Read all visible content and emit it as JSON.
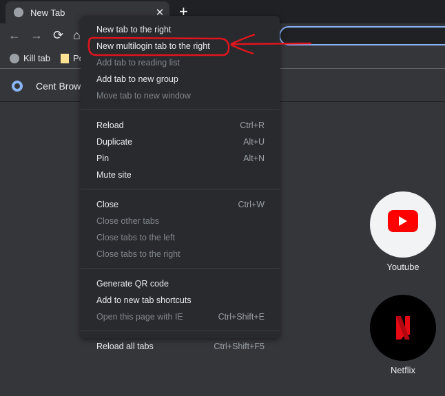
{
  "tab": {
    "title": "New Tab",
    "close": "✕",
    "new_tab": "+"
  },
  "toolbar": {
    "back": "←",
    "forward": "→",
    "reload": "⟳",
    "home": "⌂"
  },
  "bookmarks": [
    {
      "label": "Kill tab"
    },
    {
      "label": "Po"
    }
  ],
  "cent": {
    "label": "Cent Browser"
  },
  "menu": {
    "groups": [
      [
        {
          "label": "New tab to the right",
          "enabled": true
        },
        {
          "label": "New multilogin tab to the right",
          "enabled": true,
          "highlighted": true
        },
        {
          "label": "Add tab to reading list",
          "enabled": false
        },
        {
          "label": "Add tab to new group",
          "enabled": true
        },
        {
          "label": "Move tab to new window",
          "enabled": false
        }
      ],
      [
        {
          "label": "Reload",
          "shortcut": "Ctrl+R",
          "enabled": true
        },
        {
          "label": "Duplicate",
          "shortcut": "Alt+U",
          "enabled": true
        },
        {
          "label": "Pin",
          "shortcut": "Alt+N",
          "enabled": true
        },
        {
          "label": "Mute site",
          "enabled": true
        }
      ],
      [
        {
          "label": "Close",
          "shortcut": "Ctrl+W",
          "enabled": true
        },
        {
          "label": "Close other tabs",
          "enabled": false
        },
        {
          "label": "Close tabs to the left",
          "enabled": false
        },
        {
          "label": "Close tabs to the right",
          "enabled": false
        }
      ],
      [
        {
          "label": "Generate QR code",
          "enabled": true
        },
        {
          "label": "Add to new tab shortcuts",
          "enabled": true
        },
        {
          "label": "Open this page with IE",
          "shortcut": "Ctrl+Shift+E",
          "enabled": false
        }
      ],
      [
        {
          "label": "Reload all tabs",
          "shortcut": "Ctrl+Shift+F5",
          "enabled": true
        }
      ]
    ]
  },
  "shortcuts": [
    {
      "label": "Youtube",
      "brand_color": "#ff0000"
    },
    {
      "label": "Netflix",
      "brand_color": "#e50914"
    }
  ],
  "annotation_color": "#e0141e"
}
